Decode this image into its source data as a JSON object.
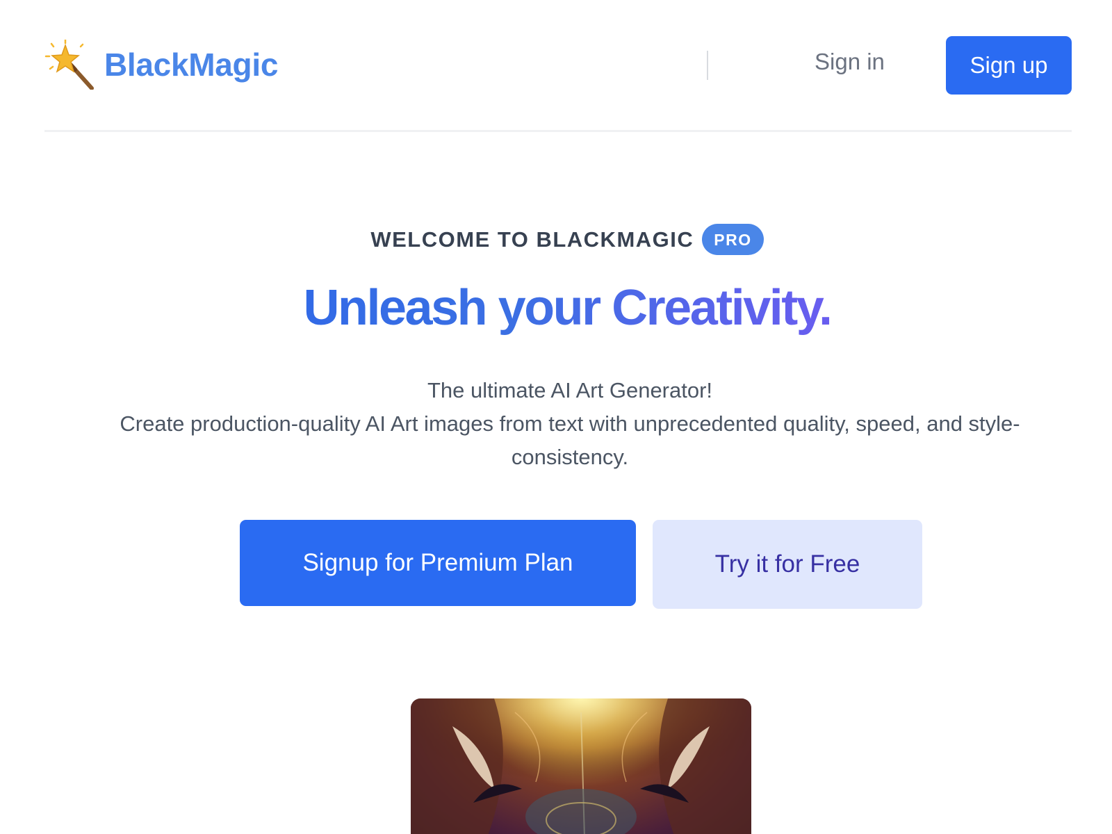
{
  "header": {
    "brand_name": "BlackMagic",
    "brand_icon": "magic-wand-sparkle-icon",
    "signin_label": "Sign in",
    "signup_label": "Sign up"
  },
  "hero": {
    "eyebrow": "WELCOME TO BLACKMAGIC",
    "badge": "PRO",
    "headline": "Unleash your Creativity.",
    "description_line1": "The ultimate AI Art Generator!",
    "description_line2": "Create production-quality AI Art images from text with unprecedented quality, speed, and style-consistency.",
    "cta_primary": "Signup for Premium Plan",
    "cta_secondary": "Try it for Free"
  },
  "colors": {
    "primary": "#2a6bf2",
    "brand_text": "#4a86e8",
    "secondary_button_bg": "#e0e7fd",
    "secondary_button_text": "#3730a3",
    "gradient_start": "#2563eb",
    "gradient_end": "#7c3aed"
  }
}
